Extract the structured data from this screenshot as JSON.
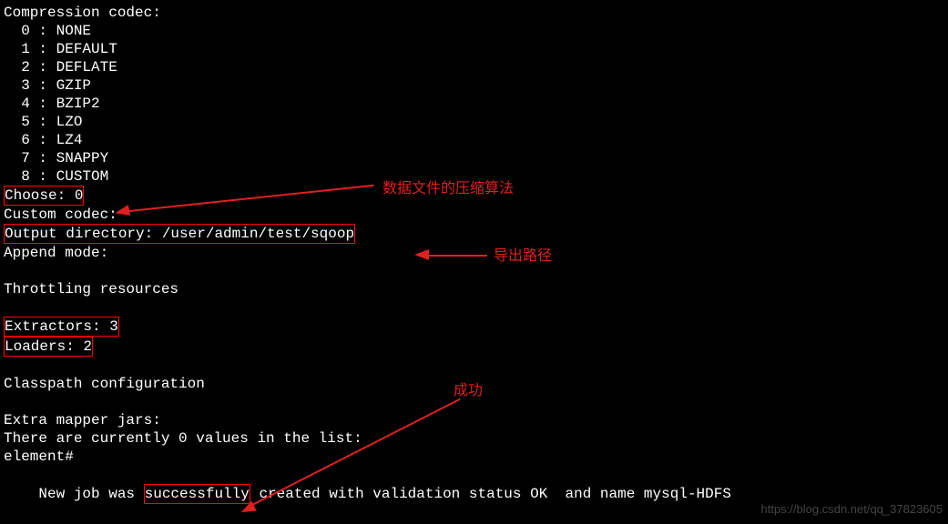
{
  "term": {
    "codec_header": "Compression codec:",
    "codec_options": [
      "  0 : NONE",
      "  1 : DEFAULT",
      "  2 : DEFLATE",
      "  3 : GZIP",
      "  4 : BZIP2",
      "  5 : LZO",
      "  6 : LZ4",
      "  7 : SNAPPY",
      "  8 : CUSTOM"
    ],
    "choose": "Choose: 0",
    "custom_codec": "Custom codec:",
    "output_dir": "Output directory: /user/admin/test/sqoop",
    "append_mode": "Append mode:",
    "throttling": "Throttling resources",
    "extractors": "Extractors: 3",
    "loaders": "Loaders: 2",
    "classpath": "Classpath configuration",
    "extra_jars": "Extra mapper jars:",
    "values_list": "There are currently 0 values in the list:",
    "element_prompt": "element#",
    "result_pre": "New job was ",
    "result_success": "successfully",
    "result_post": " created with validation status OK  and name mysql-HDFS"
  },
  "annotations": {
    "compress": "数据文件的压缩算法",
    "export_path": "导出路径",
    "success": "成功"
  },
  "watermark": "https://blog.csdn.net/qq_37823605"
}
